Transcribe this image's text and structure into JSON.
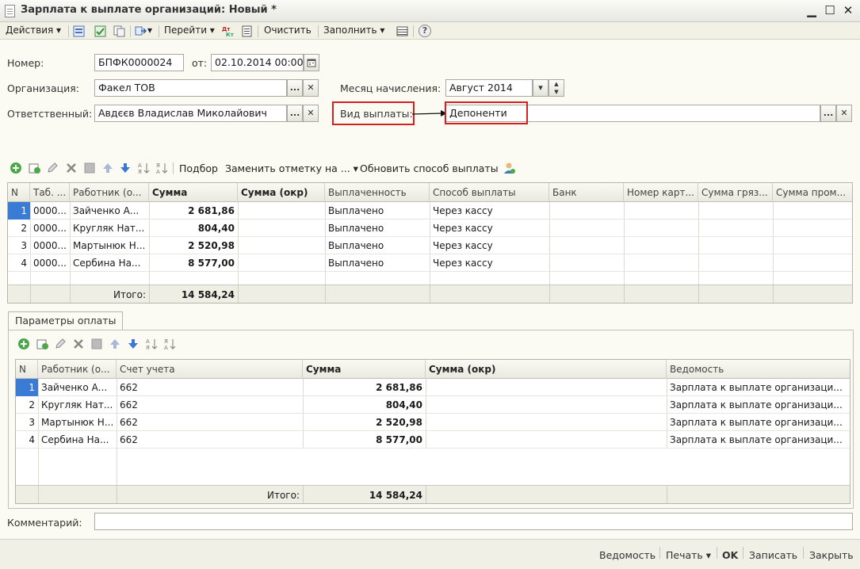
{
  "window": {
    "title": "Зарплата к выплате организаций: Новый *",
    "minimize": "▁",
    "maximize": "☐",
    "close": "✕"
  },
  "toolbar": {
    "actions": "Действия ▾",
    "goto": "Перейти ▾",
    "clear": "Очистить",
    "fill": "Заполнить ▾",
    "help": "?"
  },
  "form": {
    "number_label": "Номер:",
    "number_value": "БПФК0000024",
    "date_label": "от:",
    "date_value": "02.10.2014 00:00:00",
    "org_label": "Организация:",
    "org_value": "Факел ТОВ",
    "month_label": "Месяц начисления:",
    "month_value": "Август 2014",
    "resp_label": "Ответственный:",
    "resp_value": "Авдєєв Владислав Миколайович",
    "paytype_label": "Вид выплаты:",
    "paytype_value": "Депоненти"
  },
  "table_toolbar": {
    "select": "Подбор",
    "replace_mark": "Заменить отметку на ... ▾",
    "update_method": "Обновить способ выплаты"
  },
  "table1": {
    "headers": [
      "N",
      "Таб. ...",
      "Работник (о...",
      "Сумма",
      "Сумма (окр)",
      "Выплаченность",
      "Способ выплаты",
      "Банк",
      "Номер карт...",
      "Сумма гряз...",
      "Сумма пром..."
    ],
    "rows": [
      [
        "1",
        "0000...",
        "Зайченко А...",
        "2 681,86",
        "",
        "Выплачено",
        "Через кассу"
      ],
      [
        "2",
        "0000...",
        "Кругляк Нат...",
        "804,40",
        "",
        "Выплачено",
        "Через кассу"
      ],
      [
        "3",
        "0000...",
        "Мартынюк Н...",
        "2 520,98",
        "",
        "Выплачено",
        "Через кассу"
      ],
      [
        "4",
        "0000...",
        "Сербина На...",
        "8 577,00",
        "",
        "Выплачено",
        "Через кассу"
      ]
    ],
    "total_label": "Итого:",
    "total_value": "14 584,24"
  },
  "tabs": {
    "payment_params": "Параметры оплаты"
  },
  "table2": {
    "headers": [
      "N",
      "Работник (о...",
      "Счет учета",
      "Сумма",
      "Сумма (окр)",
      "Ведомость"
    ],
    "rows": [
      [
        "1",
        "Зайченко А...",
        "662",
        "2 681,86",
        "",
        "Зарплата к выплате организаци..."
      ],
      [
        "2",
        "Кругляк Нат...",
        "662",
        "804,40",
        "",
        "Зарплата к выплате организаци..."
      ],
      [
        "3",
        "Мартынюк Н...",
        "662",
        "2 520,98",
        "",
        "Зарплата к выплате организаци..."
      ],
      [
        "4",
        "Сербина На...",
        "662",
        "8 577,00",
        "",
        "Зарплата к выплате организаци..."
      ]
    ],
    "total_label": "Итого:",
    "total_value": "14 584,24"
  },
  "comment": {
    "label": "Комментарий:",
    "value": ""
  },
  "bottom": {
    "statement": "Ведомость",
    "print": "Печать ▾",
    "ok": "OK",
    "save": "Записать",
    "close": "Закрыть"
  }
}
